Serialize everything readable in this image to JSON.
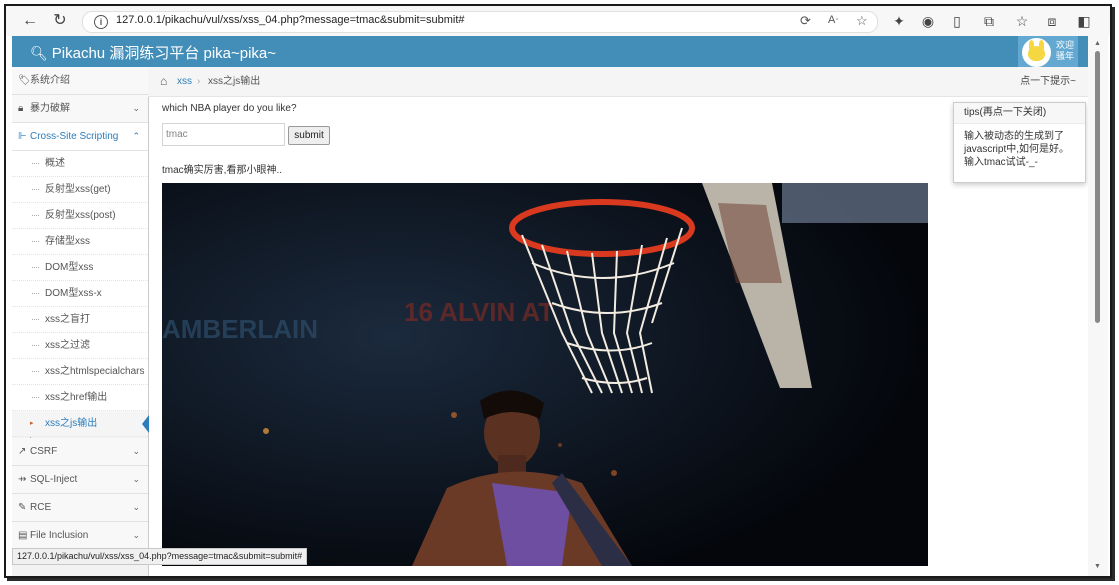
{
  "browser": {
    "url": "127.0.0.1/pikachu/vul/xss/xss_04.php?message=tmac&submit=submit#"
  },
  "header": {
    "title": "Pikachu 漏洞练习平台 pika~pika~",
    "user_line1": "欢迎",
    "user_line2": "骚年"
  },
  "sidebar": {
    "items": [
      {
        "label": "系统介绍",
        "icon": "tag-icon"
      },
      {
        "label": "暴力破解",
        "icon": "lock-icon"
      },
      {
        "label": "Cross-Site Scripting",
        "icon": "sitemap-icon"
      },
      {
        "label": "CSRF",
        "icon": "external-link-icon"
      },
      {
        "label": "SQL-Inject",
        "icon": "syringe-icon"
      },
      {
        "label": "RCE",
        "icon": "pencil-icon"
      },
      {
        "label": "File Inclusion",
        "icon": "file-icon"
      }
    ],
    "xss_sub": [
      "概述",
      "反射型xss(get)",
      "反射型xss(post)",
      "存储型xss",
      "DOM型xss",
      "DOM型xss-x",
      "xss之盲打",
      "xss之过滤",
      "xss之htmlspecialchars",
      "xss之href输出",
      "xss之js输出"
    ],
    "active": "xss之js输出"
  },
  "breadcrumb": {
    "section": "xss",
    "current": "xss之js输出",
    "hint": "点一下提示~"
  },
  "form": {
    "question": "which NBA player do you like?",
    "input_value": "tmac",
    "submit_label": "submit"
  },
  "result_text": "tmac确实厉害,看那小眼神..",
  "tips": {
    "title": "tips(再点一下关闭)",
    "line1": "输入被动态的生成到了",
    "line2": "javascript中,如何是好。",
    "line3": "输入tmac试试-_-"
  },
  "status_url": "127.0.0.1/pikachu/vul/xss/xss_04.php?message=tmac&submit=submit#",
  "photo": {
    "banner_text1": "AMBERLAIN",
    "banner_text2": "16 ALVIN AT"
  },
  "colors": {
    "header": "#438eb9",
    "accent": "#2b7dbc",
    "photo_bg": "#05080f"
  }
}
